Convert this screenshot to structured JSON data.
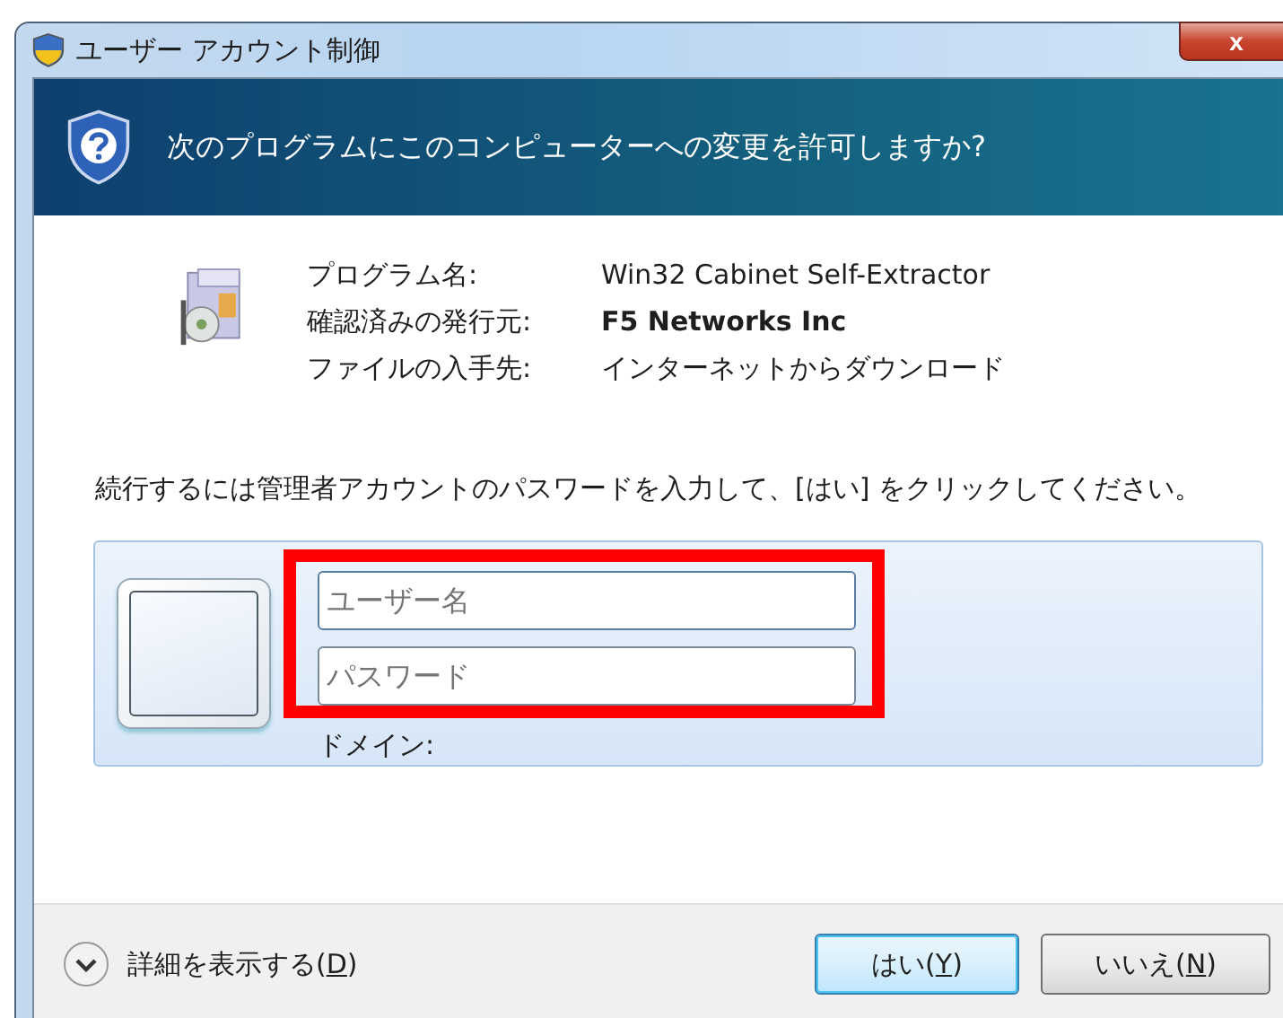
{
  "window": {
    "title": "ユーザー アカウント制御",
    "close": "x"
  },
  "banner": {
    "question": "次のプログラムにこのコンピューターへの変更を許可しますか?"
  },
  "program_info": [
    {
      "label": "プログラム名:",
      "value": "Win32 Cabinet Self-Extractor",
      "bold": false
    },
    {
      "label": "確認済みの発行元:",
      "value": "F5 Networks Inc",
      "bold": true
    },
    {
      "label": "ファイルの入手先:",
      "value": "インターネットからダウンロード",
      "bold": false
    }
  ],
  "prompt": "続行するには管理者アカウントのパスワードを入力して、[はい] をクリックしてください。",
  "credentials": {
    "username": {
      "placeholder": "ユーザー名"
    },
    "password": {
      "placeholder": "パスワード"
    },
    "domain_label": "ドメイン:"
  },
  "annotation": {
    "kind": "highlight",
    "color": "#ff0000"
  },
  "details": {
    "before": "詳細を表示する(",
    "accel": "D",
    "after": ")",
    "expanded": false
  },
  "buttons": [
    {
      "before": "はい(",
      "accel": "Y",
      "after": ")",
      "default": true
    },
    {
      "before": "いいえ(",
      "accel": "N",
      "after": ")",
      "default": false
    }
  ]
}
